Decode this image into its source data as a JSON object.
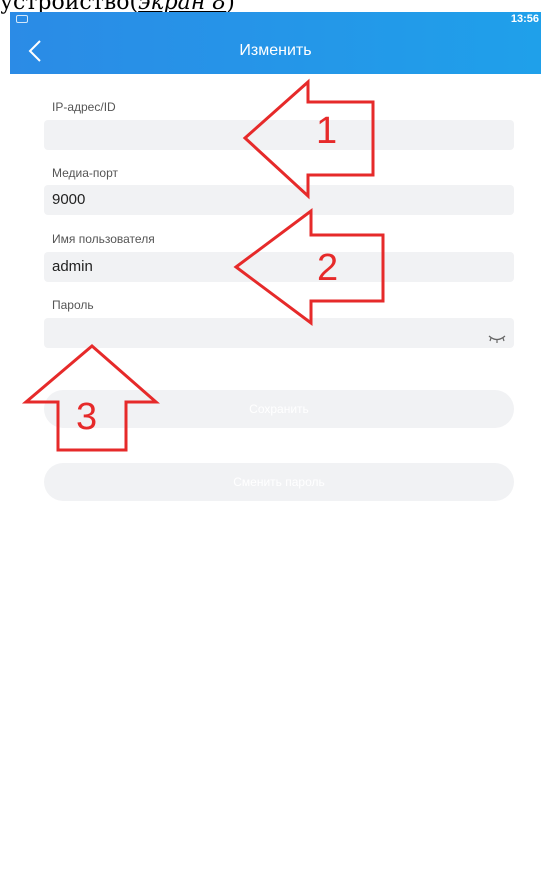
{
  "caption": {
    "prefix": "устройство(",
    "link": "экран 8",
    "suffix": ")"
  },
  "status_bar": {
    "time": "13:56"
  },
  "nav": {
    "title": "Изменить"
  },
  "form": {
    "ip": {
      "label": "IP-адрес/ID",
      "value": ""
    },
    "port": {
      "label": "Медиа-порт",
      "value": "9000"
    },
    "user": {
      "label": "Имя пользователя",
      "value": "admin"
    },
    "password": {
      "label": "Пароль",
      "value": ""
    }
  },
  "buttons": {
    "save": "Сохранить",
    "change_password": "Сменить пароль"
  },
  "annotations": {
    "arrow1": "1",
    "arrow2": "2",
    "arrow3": "3",
    "color": "#e62a2a"
  },
  "colors": {
    "header": "#2b8be6",
    "field_bg": "#f1f2f4"
  }
}
